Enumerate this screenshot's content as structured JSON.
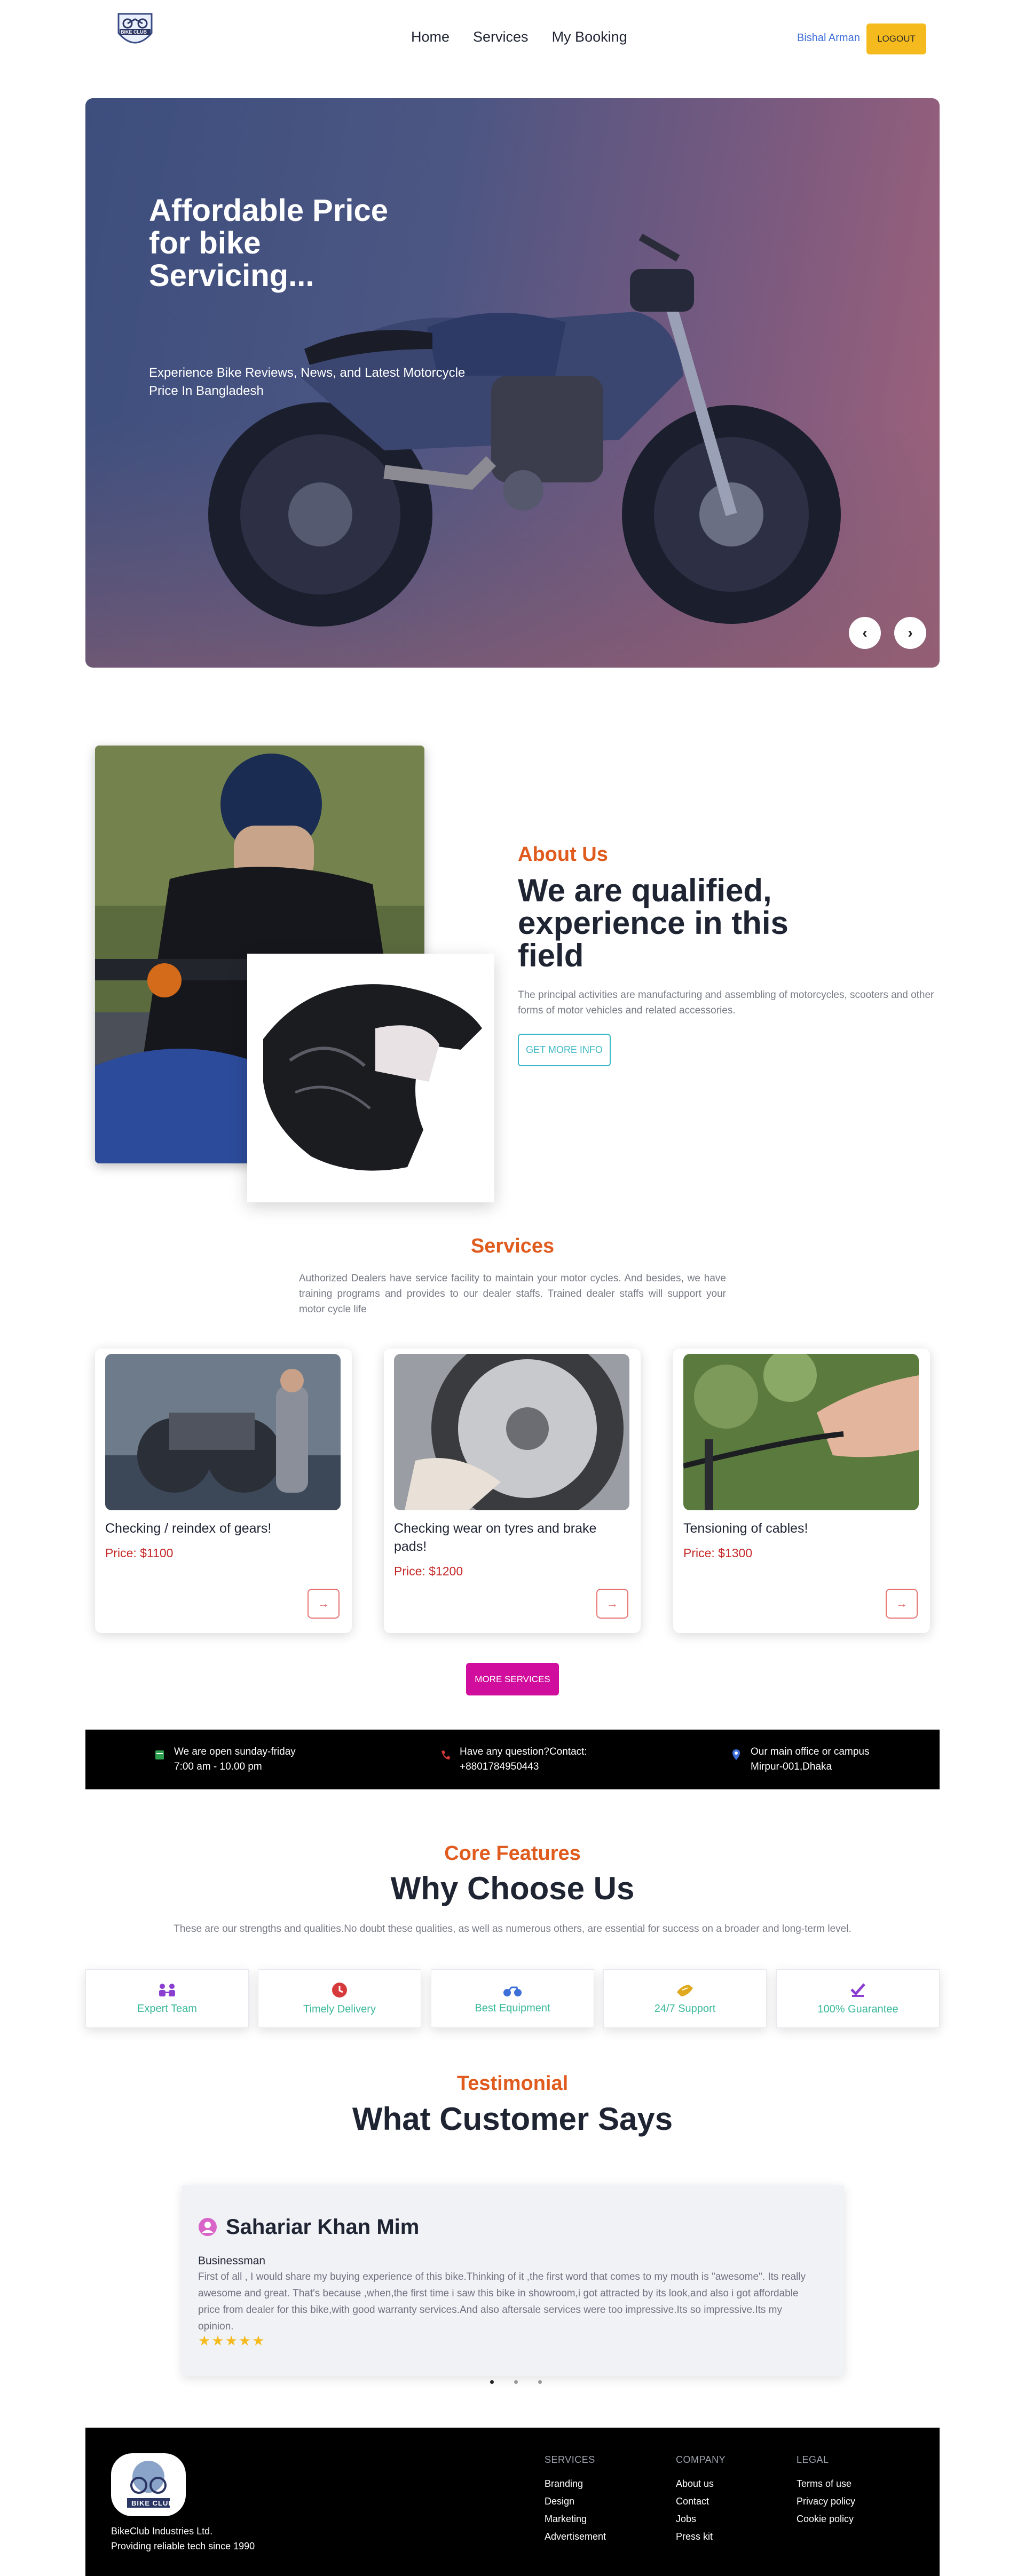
{
  "nav": {
    "logo_text": "BIKE CLUB",
    "links": [
      "Home",
      "Services",
      "My Booking"
    ],
    "user_name": "Bishal Arman",
    "logout_label": "LOGOUT"
  },
  "hero": {
    "title": "Affordable Price for bike Servicing...",
    "subtitle": "Experience Bike Reviews, News, and Latest Motorcycle Price In Bangladesh",
    "prev_icon": "‹",
    "next_icon": "›"
  },
  "about": {
    "tag": "About Us",
    "heading": "We are qualified, experience in this field",
    "text": "The principal activities are manufacturing and assembling of motorcycles, scooters and other forms of motor vehicles and related accessories.",
    "button": "GET MORE INFO"
  },
  "services": {
    "tag": "Services",
    "description": "Authorized Dealers have service facility to maintain your motor cycles. And besides, we have training programs and provides to our dealer staffs. Trained dealer staffs will support your motor cycle life",
    "items": [
      {
        "name": "Checking / reindex of gears!",
        "price": "Price: $1100"
      },
      {
        "name": "Checking wear on tyres and brake pads!",
        "price": "Price: $1200"
      },
      {
        "name": "Tensioning of cables!",
        "price": "Price: $1300"
      }
    ],
    "arrow_icon": "→",
    "more_button": "MORE SERVICES"
  },
  "info_strip": [
    {
      "line1": "We are open sunday-friday",
      "line2": "7:00 am - 10.00 pm",
      "icon": "calendar-icon",
      "color": "#2e9e4f"
    },
    {
      "line1": "Have any question?Contact:",
      "line2": "+8801784950443",
      "icon": "phone-icon",
      "color": "#d63a3a"
    },
    {
      "line1": "Our main office or campus",
      "line2": "Mirpur-001,Dhaka",
      "icon": "location-icon",
      "color": "#3d6fd9"
    }
  ],
  "features": {
    "tag": "Core Features",
    "heading": "Why Choose Us",
    "description": "These are our strengths and qualities.No doubt these qualities, as well as numerous others, are essential for success on a broader and long-term level.",
    "items": [
      {
        "label": "Expert Team",
        "icon": "team-icon",
        "color": "#8a3fd1"
      },
      {
        "label": "Timely Delivery",
        "icon": "clock-icon",
        "color": "#d63a3a"
      },
      {
        "label": "Best Equipment",
        "icon": "motorbike-icon",
        "color": "#3d6fd9"
      },
      {
        "label": "24/7 Support",
        "icon": "support-icon",
        "color": "#e0a91e"
      },
      {
        "label": "100% Guarantee",
        "icon": "check-icon",
        "color": "#8a3fd1"
      }
    ]
  },
  "testimonial": {
    "tag": "Testimonial",
    "heading": "What Customer Says",
    "name": "Sahariar Khan Mim",
    "role": "Businessman",
    "text": "First of all , I would share my buying experience of this bike.Thinking of it ,the first word that comes to my mouth is \"awesome\". Its really awesome and great. That's because ,when,the first time i saw this bike in showroom,i got attracted by its look,and also i got affordable price from dealer for this bike,with good warranty services.And also aftersale services were too impressive.Its so impressive.Its my opinion.",
    "stars": "★★★★★",
    "rating": 5
  },
  "footer": {
    "company_line1": "BikeClub Industries Ltd.",
    "company_line2": "Providing reliable tech since 1990",
    "columns": [
      {
        "title": "SERVICES",
        "items": [
          "Branding",
          "Design",
          "Marketing",
          "Advertisement"
        ]
      },
      {
        "title": "COMPANY",
        "items": [
          "About us",
          "Contact",
          "Jobs",
          "Press kit"
        ]
      },
      {
        "title": "LEGAL",
        "items": [
          "Terms of use",
          "Privacy policy",
          "Cookie policy"
        ]
      }
    ]
  }
}
